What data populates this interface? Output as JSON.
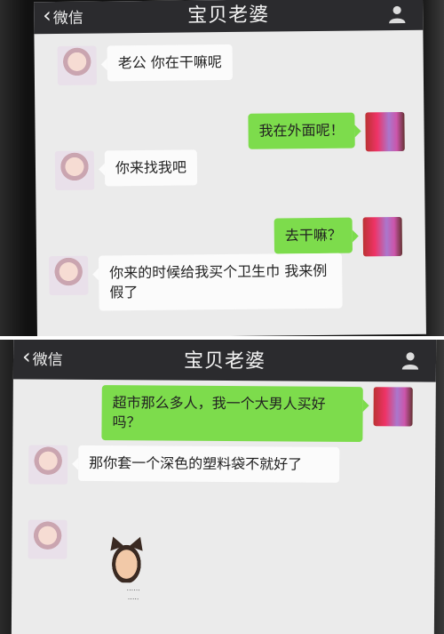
{
  "screenshot_1": {
    "header": {
      "back_label": "微信",
      "title": "宝贝老婆"
    },
    "messages": [
      {
        "side": "in",
        "text": "老公 你在干嘛呢"
      },
      {
        "side": "out",
        "text": "我在外面呢！"
      },
      {
        "side": "in",
        "text": "你来找我吧"
      },
      {
        "side": "out",
        "text": "去干嘛？"
      },
      {
        "side": "in",
        "text": "你来的时候给我买个卫生巾  我来例假了"
      }
    ]
  },
  "screenshot_2": {
    "header": {
      "back_label": "微信",
      "title": "宝贝老婆"
    },
    "messages": [
      {
        "side": "out",
        "text": "超市那么多人，我一个大男人买好吗？"
      },
      {
        "side": "in",
        "text": "那你套一个深色的塑料袋不就好了"
      },
      {
        "side": "in",
        "type": "sticker",
        "sticker_icon": "cat-girl-sticker"
      }
    ]
  },
  "colors": {
    "titlebar": "#2b2b2e",
    "chat_background": "#ebebeb",
    "incoming_bubble": "#fbfbfb",
    "outgoing_bubble": "#7ddc4c"
  }
}
